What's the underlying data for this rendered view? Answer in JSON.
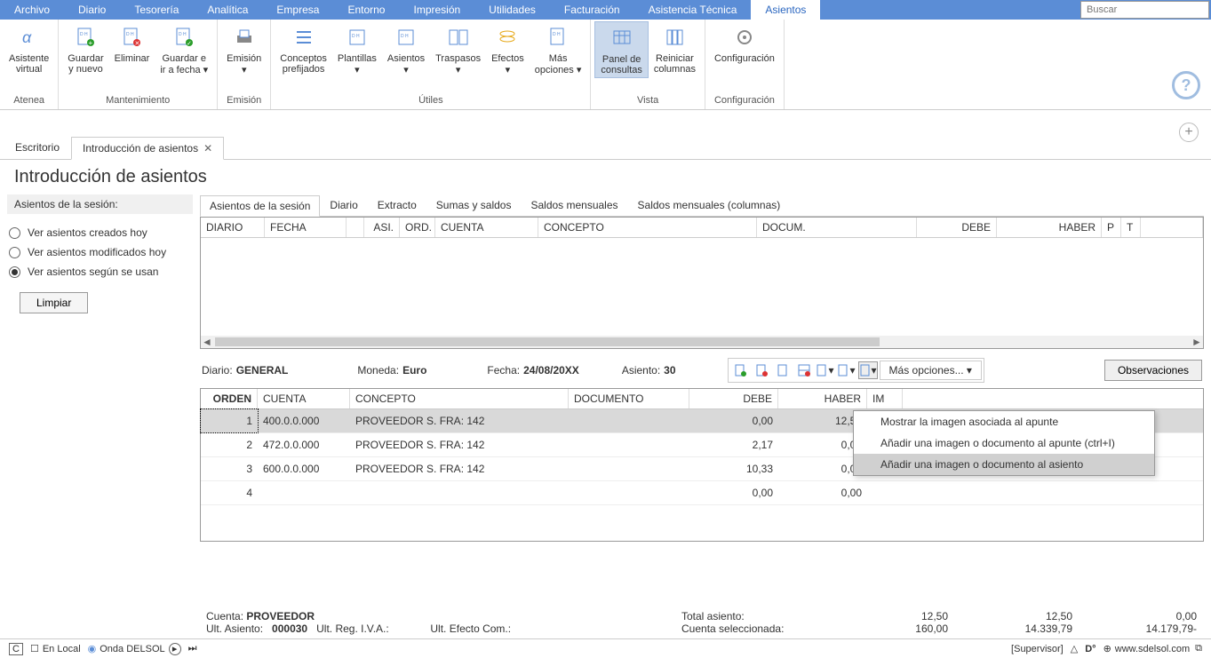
{
  "menubar": {
    "items": [
      "Archivo",
      "Diario",
      "Tesorería",
      "Analítica",
      "Empresa",
      "Entorno",
      "Impresión",
      "Utilidades",
      "Facturación",
      "Asistencia Técnica",
      "Asientos"
    ],
    "active": 10,
    "search_placeholder": "Buscar"
  },
  "ribbon": {
    "groups": [
      {
        "label": "Atenea",
        "buttons": [
          {
            "label": "Asistente\nvirtual"
          }
        ]
      },
      {
        "label": "Mantenimiento",
        "buttons": [
          {
            "label": "Guardar\ny nuevo"
          },
          {
            "label": "Eliminar"
          },
          {
            "label": "Guardar e\nir a fecha ▾"
          }
        ]
      },
      {
        "label": "Emisión",
        "buttons": [
          {
            "label": "Emisión\n▾"
          }
        ]
      },
      {
        "label": "Útiles",
        "buttons": [
          {
            "label": "Conceptos\nprefijados"
          },
          {
            "label": "Plantillas\n▾"
          },
          {
            "label": "Asientos\n▾"
          },
          {
            "label": "Traspasos\n▾"
          },
          {
            "label": "Efectos\n▾"
          },
          {
            "label": "Más\nopciones ▾"
          }
        ]
      },
      {
        "label": "Vista",
        "buttons": [
          {
            "label": "Panel de\nconsultas",
            "selected": true
          },
          {
            "label": "Reiniciar\ncolumnas"
          }
        ]
      },
      {
        "label": "Configuración",
        "buttons": [
          {
            "label": "Configuración"
          }
        ]
      }
    ]
  },
  "tabs": {
    "items": [
      {
        "label": "Escritorio"
      },
      {
        "label": "Introducción de asientos",
        "close": true,
        "active": true
      }
    ]
  },
  "page_title": "Introducción de asientos",
  "sidebar": {
    "header": "Asientos de la sesión:",
    "radios": [
      {
        "label": "Ver asientos creados hoy",
        "checked": false
      },
      {
        "label": "Ver asientos modificados hoy",
        "checked": false
      },
      {
        "label": "Ver asientos según se usan",
        "checked": true
      }
    ],
    "limpiar": "Limpiar"
  },
  "subtabs": {
    "items": [
      "Asientos de la sesión",
      "Diario",
      "Extracto",
      "Sumas y saldos",
      "Saldos mensuales",
      "Saldos mensuales (columnas)"
    ],
    "active": 0
  },
  "grid1_headers": [
    "DIARIO",
    "FECHA",
    "",
    "ASI.",
    "ORD.",
    "CUENTA",
    "CONCEPTO",
    "DOCUM.",
    "DEBE",
    "HABER",
    "P",
    "T",
    ""
  ],
  "info": {
    "diario_lbl": "Diario:",
    "diario_val": "GENERAL",
    "moneda_lbl": "Moneda:",
    "moneda_val": "Euro",
    "fecha_lbl": "Fecha:",
    "fecha_val": "24/08/20XX",
    "asiento_lbl": "Asiento:",
    "asiento_val": "30",
    "more": "Más opciones... ▾",
    "obs": "Observaciones"
  },
  "grid2": {
    "headers": [
      "ORDEN",
      "CUENTA",
      "CONCEPTO",
      "DOCUMENTO",
      "DEBE",
      "HABER",
      "IM"
    ],
    "rows": [
      {
        "orden": "1",
        "cuenta": "400.0.0.000",
        "concepto": "PROVEEDOR S. FRA:  142",
        "doc": "",
        "debe": "0,00",
        "haber": "12,50",
        "sel": true
      },
      {
        "orden": "2",
        "cuenta": "472.0.0.000",
        "concepto": "PROVEEDOR S. FRA:  142",
        "doc": "",
        "debe": "2,17",
        "haber": "0,00"
      },
      {
        "orden": "3",
        "cuenta": "600.0.0.000",
        "concepto": "PROVEEDOR S. FRA:  142",
        "doc": "",
        "debe": "10,33",
        "haber": "0,00"
      },
      {
        "orden": "4",
        "cuenta": "",
        "concepto": "",
        "doc": "",
        "debe": "0,00",
        "haber": "0,00"
      }
    ]
  },
  "context": {
    "items": [
      {
        "label": "Mostrar la imagen asociada al apunte"
      },
      {
        "label": "Añadir una imagen o documento al apunte (ctrl+I)"
      },
      {
        "label": "Añadir una imagen o documento al asiento",
        "hover": true
      }
    ]
  },
  "footer": {
    "cuenta_lbl": "Cuenta:",
    "cuenta_val": "PROVEEDOR",
    "ult_asiento_lbl": "Ult. Asiento:",
    "ult_asiento_val": "000030",
    "ult_reg_lbl": "Ult. Reg. I.V.A.:",
    "ult_reg_val": "",
    "ult_efecto_lbl": "Ult. Efecto Com.:",
    "ult_efecto_val": "",
    "total_lbl": "Total asiento:",
    "cuenta_sel_lbl": "Cuenta seleccionada:",
    "col1_a": "12,50",
    "col1_b": "160,00",
    "col2_a": "12,50",
    "col2_b": "14.339,79",
    "col3_a": "0,00",
    "col3_b": "14.179,79-"
  },
  "status": {
    "local": "En Local",
    "onda": "Onda DELSOL",
    "supervisor": "[Supervisor]",
    "site": "www.sdelsol.com"
  }
}
